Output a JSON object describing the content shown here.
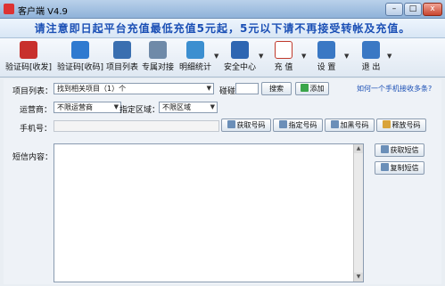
{
  "window": {
    "title": "客户端 V4.9",
    "min_label": "–",
    "max_label": "□",
    "close_label": "x"
  },
  "notice": {
    "text": "请注意即日起平台充值最低充值5元起，5元以下请不再接受转帐及充值。"
  },
  "toolbar": {
    "items": [
      {
        "label": "验证码[收发]",
        "icon": "sms-send-icon",
        "color": "#c8302c"
      },
      {
        "label": "验证码[收码]",
        "icon": "sms-receive-icon",
        "color": "#2f7ad0"
      },
      {
        "label": "项目列表",
        "icon": "monitor-list-icon",
        "color": "#3a6fb0"
      },
      {
        "label": "专属对接",
        "icon": "link-icon",
        "color": "#6f8aa8"
      },
      {
        "label": "明细统计",
        "icon": "bar-chart-icon",
        "color": "#3c8fd0"
      },
      {
        "label": "安全中心",
        "icon": "shield-user-icon",
        "color": "#2e66b2"
      },
      {
        "label": "充 值",
        "icon": "pdf-icon",
        "color": "#c0392b"
      },
      {
        "label": "设 置",
        "icon": "wrench-icon",
        "color": "#3a78c4"
      },
      {
        "label": "退 出",
        "icon": "exit-icon",
        "color": "#3a78c4"
      }
    ]
  },
  "form": {
    "project_label": "项目列表：",
    "project_value": "找到相关项目（1）个",
    "search_label": "碰碰",
    "search_button": "搜索",
    "add_button": "添加",
    "help_link": "如何一个手机接收多条?",
    "carrier_label": "运营商：",
    "carrier_value": "不限运营商",
    "region_label": "指定区域：",
    "region_value": "不限区域",
    "phone_label": "手机号：",
    "get_number_button": "获取号码",
    "specify_number_button": "指定号码",
    "blacklist_button": "加黑号码",
    "release_button": "释放号码",
    "sms_label": "短信内容：",
    "get_sms_button": "获取短信",
    "copy_sms_button": "复制短信"
  }
}
